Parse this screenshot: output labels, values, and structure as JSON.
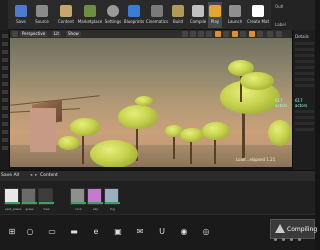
{
  "toolbar": {
    "buttons": [
      {
        "label": "Save",
        "icon": "save-icon",
        "color": "#4d7bd1"
      },
      {
        "label": "Source",
        "icon": "source-control-icon",
        "color": "#8a8a8a"
      },
      {
        "label": "Content",
        "icon": "content-icon",
        "color": "#c8a56a"
      },
      {
        "label": "Marketplace",
        "icon": "marketplace-icon",
        "color": "#6b8f3e"
      },
      {
        "label": "Settings",
        "icon": "gear-icon",
        "color": "#9a9a9a"
      },
      {
        "label": "Blueprints",
        "icon": "blueprint-icon",
        "color": "#3a7bd5"
      },
      {
        "label": "Cinematics",
        "icon": "cinematics-icon",
        "color": "#7a7a7a"
      },
      {
        "label": "Build",
        "icon": "build-icon",
        "color": "#b09a55"
      },
      {
        "label": "Compile",
        "icon": "compile-icon",
        "color": "#c0c0c0"
      },
      {
        "label": "Play",
        "icon": "play-icon",
        "color": "#e2a533"
      },
      {
        "label": "Launch",
        "icon": "launch-icon",
        "color": "#8f8f8f"
      },
      {
        "label": "Create Mat",
        "icon": "material-icon",
        "color": "#ffffff"
      }
    ]
  },
  "right_tab": {
    "title": "Outl",
    "label": "Label"
  },
  "viewport": {
    "view_mode": "Perspective",
    "lit_mode": "Lit",
    "show": "Show",
    "status_text": "Load...elapsed 1.21",
    "fps_text": "617 actors"
  },
  "right_panel": {
    "title": "Details",
    "actors": "617 actors"
  },
  "content_browser": {
    "save_all": "Save All",
    "path": "Content",
    "assets": [
      {
        "name": "spot_plane",
        "color": "#e8e8e8"
      },
      {
        "name": "grass",
        "color": "#6a6a6a"
      },
      {
        "name": "tree",
        "color": "#3c3c3c"
      },
      {
        "name": "rock",
        "color": "#8f8f8f"
      },
      {
        "name": "sky",
        "color": "#c57ad0"
      },
      {
        "name": "fog",
        "color": "#9ab0c0"
      }
    ]
  },
  "taskbar": {
    "compiling": "Compiling",
    "icons": [
      "windows-start-icon",
      "search-icon",
      "task-view-icon",
      "explorer-icon",
      "edge-icon",
      "store-icon",
      "mail-icon",
      "unreal-icon",
      "chrome-icon",
      "steam-icon"
    ]
  }
}
